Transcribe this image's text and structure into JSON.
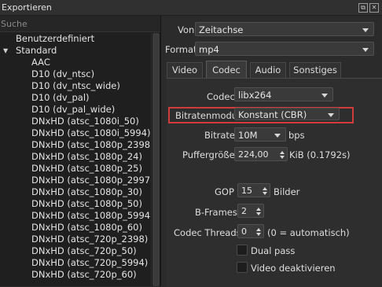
{
  "window": {
    "title": "Exportieren",
    "float_icon": "float-icon",
    "close_icon": "close-icon"
  },
  "left": {
    "search_placeholder": "Suche",
    "groups": [
      {
        "label": "Benutzerdefiniert",
        "expanded": false
      },
      {
        "label": "Standard",
        "expanded": true
      }
    ],
    "items": [
      "AAC",
      "D10 (dv_ntsc)",
      "D10 (dv_ntsc_wide)",
      "D10 (dv_pal)",
      "D10 (dv_pal_wide)",
      "DNxHD (atsc_1080i_50)",
      "DNxHD (atsc_1080i_5994)",
      "DNxHD (atsc_1080p_2398)",
      "DNxHD (atsc_1080p_24)",
      "DNxHD (atsc_1080p_25)",
      "DNxHD (atsc_1080p_2997)",
      "DNxHD (atsc_1080p_30)",
      "DNxHD (atsc_1080p_50)",
      "DNxHD (atsc_1080p_5994)",
      "DNxHD (atsc_1080p_60)",
      "DNxHD (atsc_720p_2398)",
      "DNxHD (atsc_720p_50)",
      "DNxHD (atsc_720p_5994)",
      "DNxHD (atsc_720p_60)"
    ]
  },
  "right": {
    "from_label": "Von",
    "from_value": "Zeitachse",
    "format_label": "Format",
    "format_value": "mp4",
    "tabs": [
      "Video",
      "Codec",
      "Audio",
      "Sonstiges"
    ],
    "active_tab": "Codec",
    "codec": {
      "codec_label": "Codec",
      "codec_value": "libx264",
      "rate_mode_label": "Bitratenmodus",
      "rate_mode_value": "Konstant (CBR)",
      "bitrate_label": "Bitrate",
      "bitrate_value": "10M",
      "bitrate_unit": "bps",
      "buffer_label": "Puffergröße",
      "buffer_value": "224,00",
      "buffer_unit": "KiB (0.1792s)",
      "gop_label": "GOP",
      "gop_value": "15",
      "gop_unit": "Bilder",
      "bframes_label": "B-Frames",
      "bframes_value": "2",
      "threads_label": "Codec Threads",
      "threads_value": "0",
      "threads_hint": "(0 = automatisch)",
      "dual_pass_label": "Dual pass",
      "dual_pass_checked": false,
      "disable_video_label": "Video deaktivieren",
      "disable_video_checked": false
    },
    "highlight_color": "#d23b3b"
  }
}
